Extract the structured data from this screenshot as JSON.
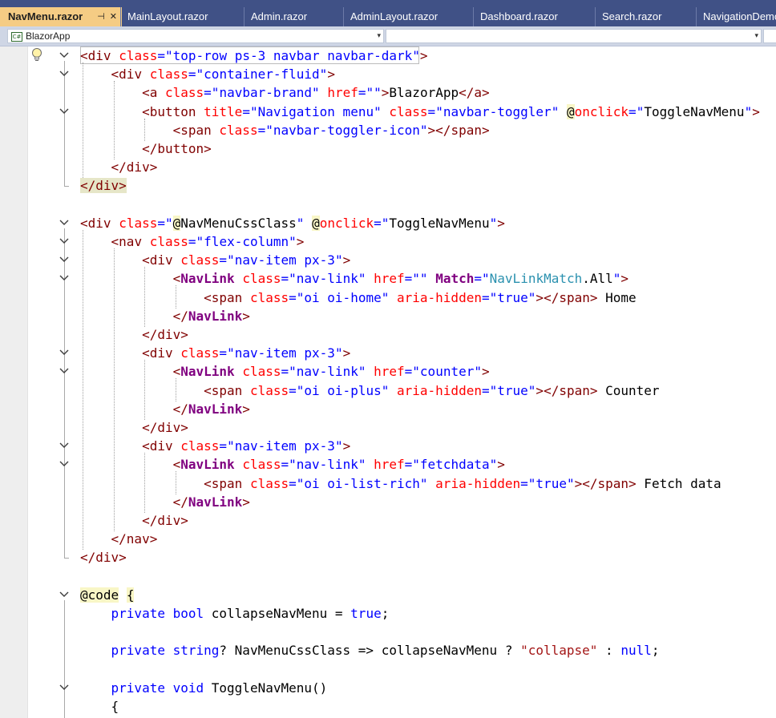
{
  "tabs": [
    {
      "label": "NavMenu.razor",
      "active": true,
      "pin_icon": "pin-icon",
      "close_icon": "close-icon"
    },
    {
      "label": "MainLayout.razor"
    },
    {
      "label": "Admin.razor"
    },
    {
      "label": "AdminLayout.razor"
    },
    {
      "label": "Dashboard.razor"
    },
    {
      "label": "Search.razor"
    },
    {
      "label": "NavigationDemo"
    }
  ],
  "navbar": {
    "project_dropdown": "BlazorApp",
    "member_dropdown": ""
  },
  "code_lines": [
    "<div class=\"top-row ps-3 navbar navbar-dark\">",
    "    <div class=\"container-fluid\">",
    "        <a class=\"navbar-brand\" href=\"\">BlazorApp</a>",
    "        <button title=\"Navigation menu\" class=\"navbar-toggler\" @onclick=\"ToggleNavMenu\">",
    "            <span class=\"navbar-toggler-icon\"></span>",
    "        </button>",
    "    </div>",
    "</div>",
    "",
    "<div class=\"@NavMenuCssClass\" @onclick=\"ToggleNavMenu\">",
    "    <nav class=\"flex-column\">",
    "        <div class=\"nav-item px-3\">",
    "            <NavLink class=\"nav-link\" href=\"\" Match=\"NavLinkMatch.All\">",
    "                <span class=\"oi oi-home\" aria-hidden=\"true\"></span> Home",
    "            </NavLink>",
    "        </div>",
    "        <div class=\"nav-item px-3\">",
    "            <NavLink class=\"nav-link\" href=\"counter\">",
    "                <span class=\"oi oi-plus\" aria-hidden=\"true\"></span> Counter",
    "            </NavLink>",
    "        </div>",
    "        <div class=\"nav-item px-3\">",
    "            <NavLink class=\"nav-link\" href=\"fetchdata\">",
    "                <span class=\"oi oi-list-rich\" aria-hidden=\"true\"></span> Fetch data",
    "            </NavLink>",
    "        </div>",
    "    </nav>",
    "</div>",
    "",
    "@code {",
    "    private bool collapseNavMenu = true;",
    "",
    "    private string? NavMenuCssClass => collapseNavMenu ? \"collapse\" : null;",
    "",
    "    private void ToggleNavMenu()",
    "    {"
  ],
  "colors": {
    "tab_strip": "#405186",
    "active_tab": "#f5cc84",
    "element": "#800000",
    "attribute": "#ff0000",
    "attribute_value": "#0000ff",
    "component": "#800080",
    "keyword": "#0000ff",
    "type": "#2b91af",
    "string": "#a31515"
  }
}
